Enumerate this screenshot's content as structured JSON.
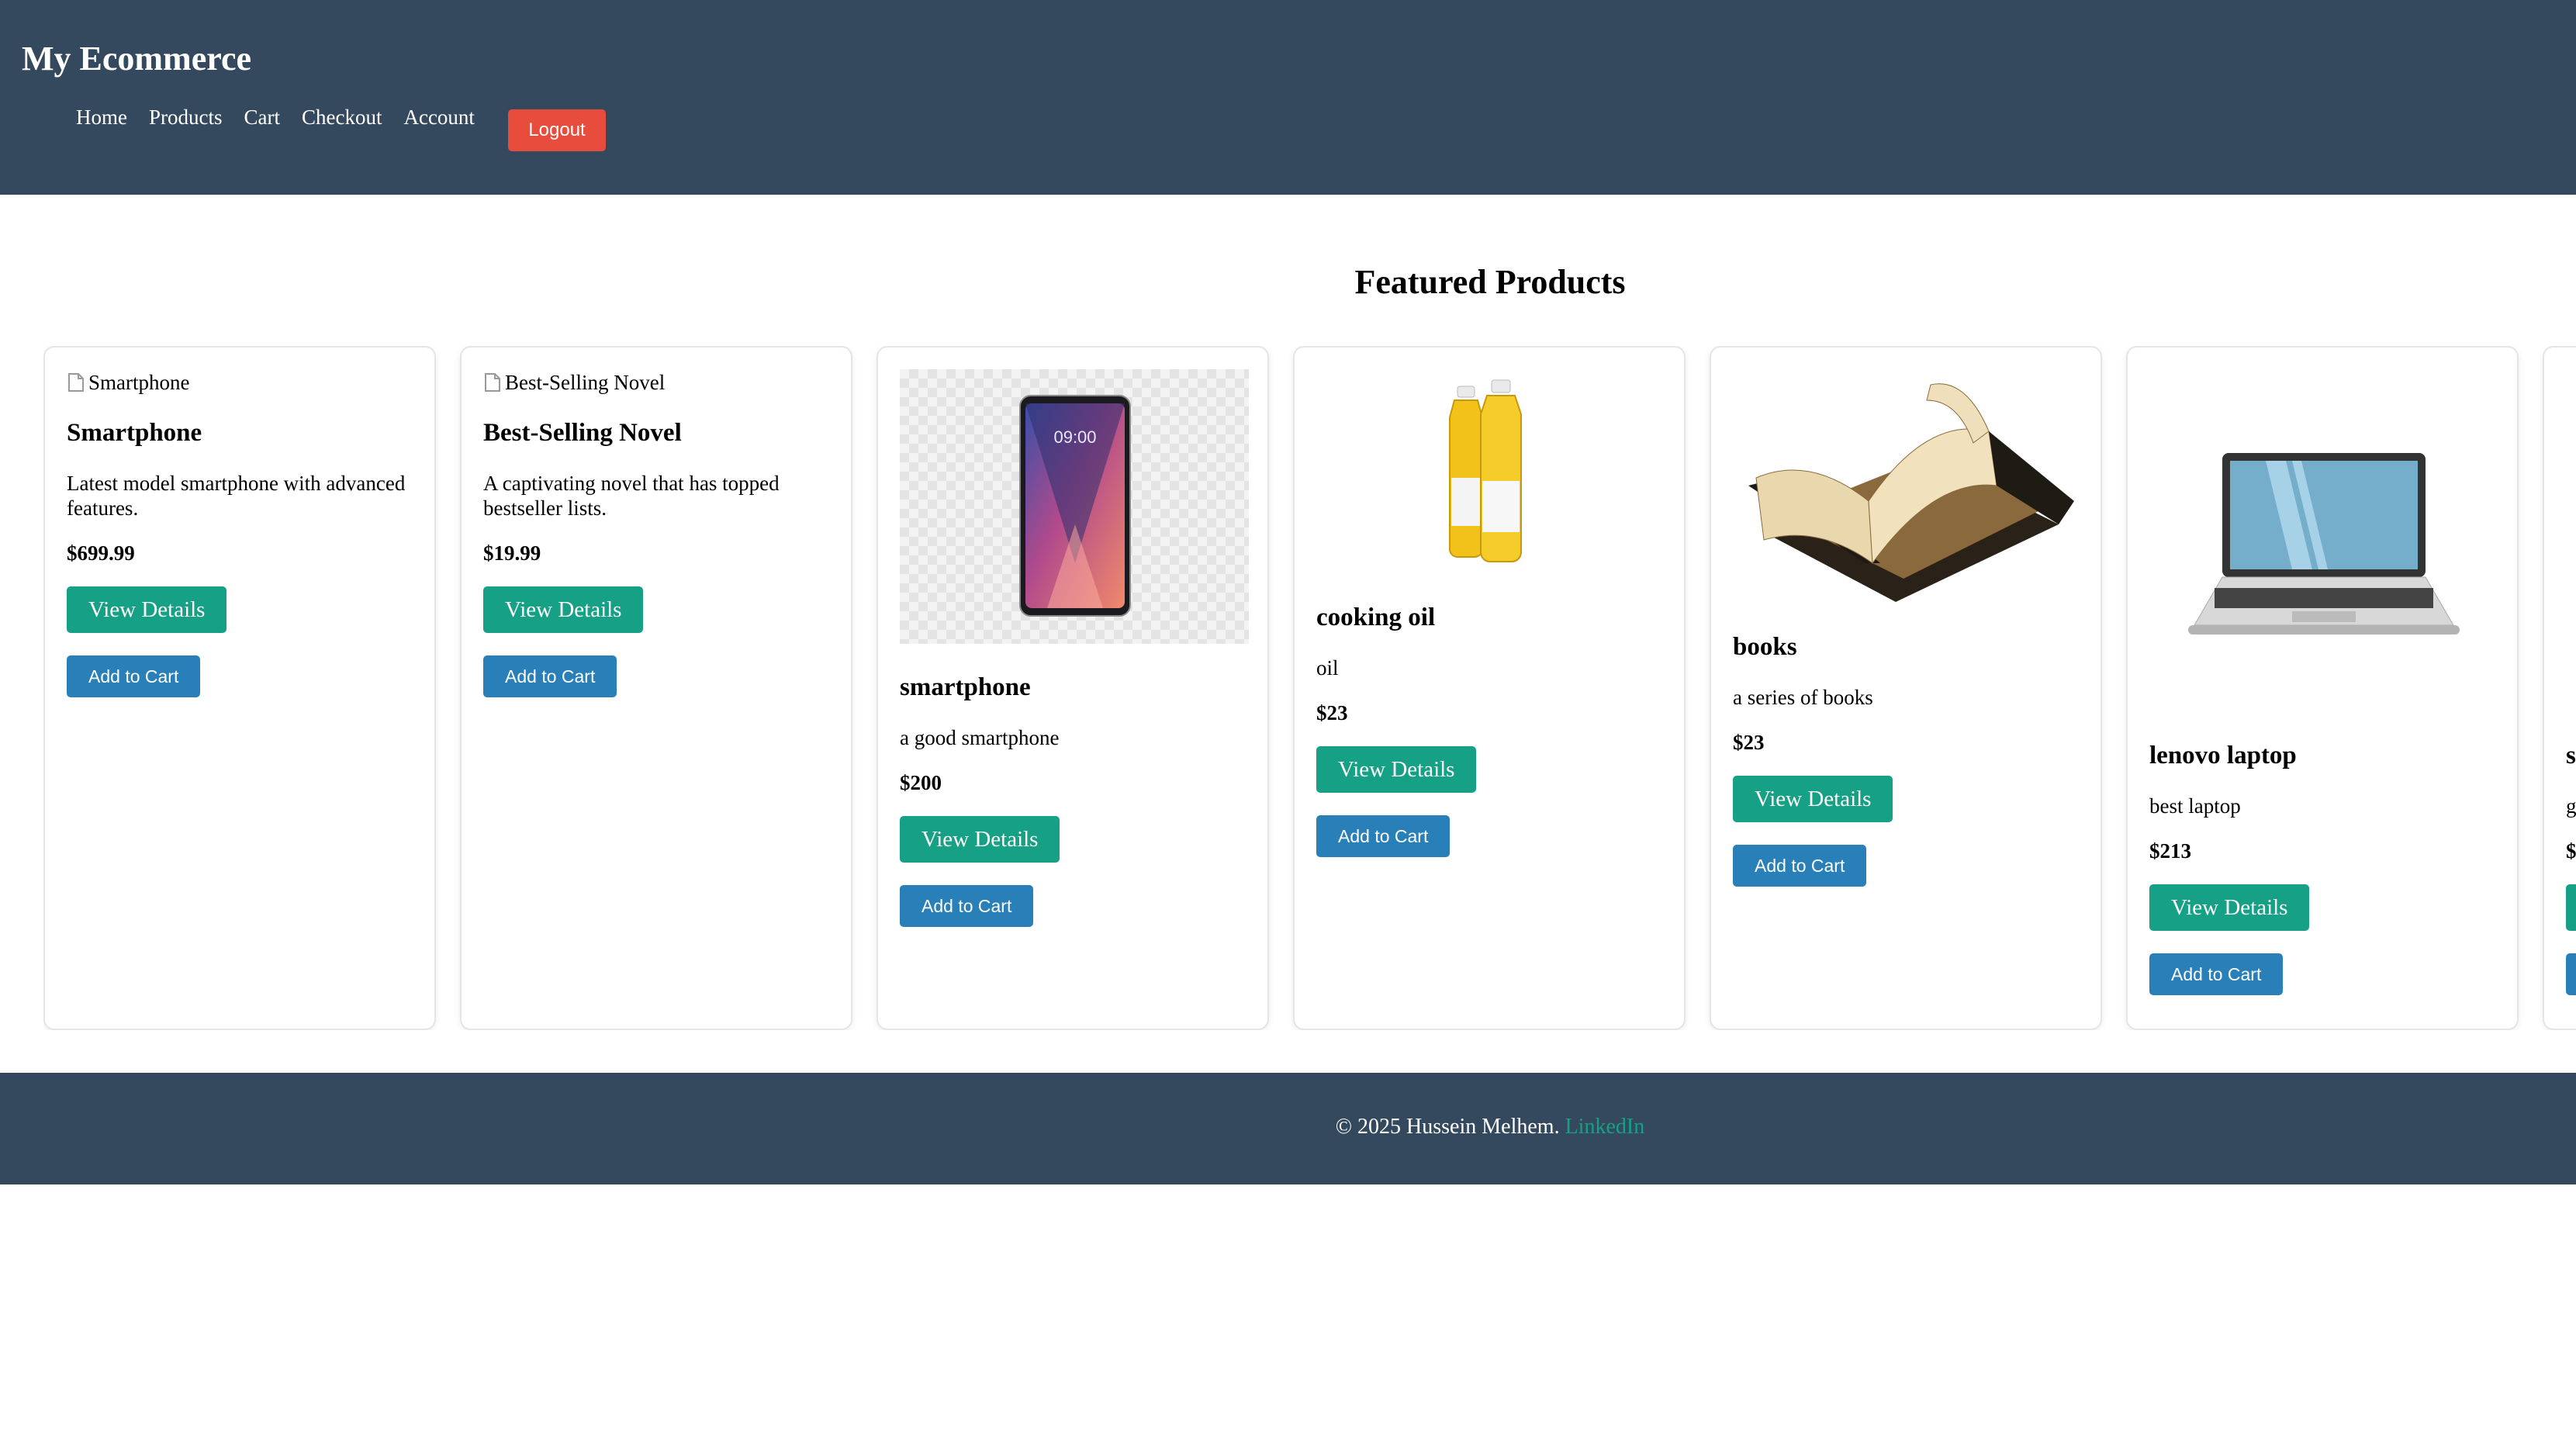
{
  "header": {
    "brand": "My Ecommerce",
    "nav": [
      "Home",
      "Products",
      "Cart",
      "Checkout",
      "Account"
    ],
    "logout_label": "Logout"
  },
  "main": {
    "section_title": "Featured Products",
    "products": [
      {
        "image_alt": "Smartphone",
        "name": "Smartphone",
        "description": "Latest model smartphone with advanced features.",
        "price": "$699.99",
        "image": "broken"
      },
      {
        "image_alt": "Best-Selling Novel",
        "name": "Best-Selling Novel",
        "description": "A captivating novel that has topped bestseller lists.",
        "price": "$19.99",
        "image": "broken"
      },
      {
        "name": "smartphone",
        "description": "a good smartphone",
        "price": "$200",
        "image": "smartphone-photo"
      },
      {
        "name": "cooking oil",
        "description": "oil",
        "price": "$23",
        "image": "cooking-oil-photo"
      },
      {
        "name": "books",
        "description": "a series of books",
        "price": "$23",
        "image": "books-photo"
      },
      {
        "name": "lenovo laptop",
        "description": "best laptop",
        "price": "$213",
        "image": "laptop-photo"
      },
      {
        "name": "s",
        "description": "g",
        "price": "$",
        "image": "unknown",
        "partially_visible": true
      }
    ],
    "view_details_label": "View Details",
    "add_to_cart_label": "Add to Cart"
  },
  "footer": {
    "copyright": "© 2025 Hussein Melhem.",
    "link_label": "LinkedIn"
  },
  "colors": {
    "header_bg": "#34495e",
    "logout": "#e74c3c",
    "view_details": "#16a085",
    "add_to_cart": "#2980b9",
    "link": "#16a085"
  }
}
